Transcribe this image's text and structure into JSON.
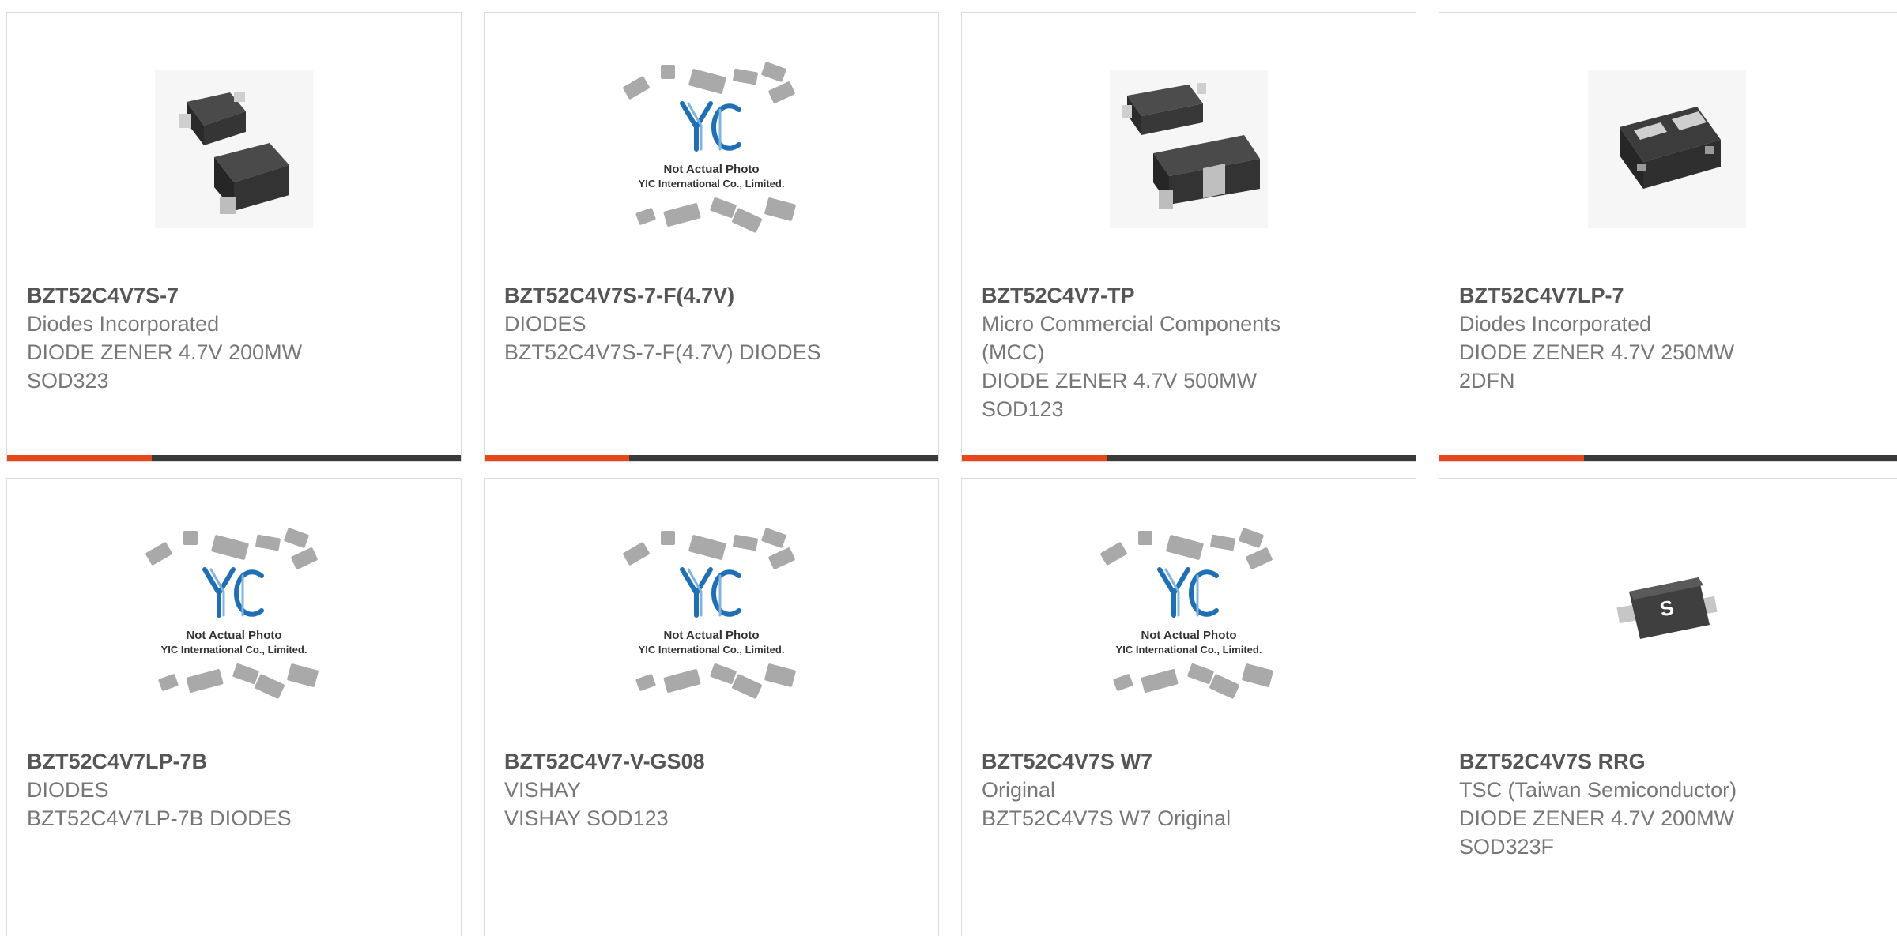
{
  "colors": {
    "accent": "#e8471b",
    "bar": "#3a3a3a",
    "title": "#555555",
    "text": "#777777"
  },
  "placeholder": {
    "line1": "Not Actual Photo",
    "line2": "YIC International Co., Limited."
  },
  "products": [
    {
      "part": "BZT52C4V7S-7",
      "lines": [
        "Diodes Incorporated",
        "DIODE ZENER 4.7V 200MW",
        "SOD323"
      ],
      "image": "sod323-diode-photo"
    },
    {
      "part": "BZT52C4V7S-7-F(4.7V)",
      "lines": [
        "DIODES",
        "BZT52C4V7S-7-F(4.7V) DIODES"
      ],
      "image": "yic-placeholder"
    },
    {
      "part": "BZT52C4V7-TP",
      "lines": [
        "Micro Commercial Components",
        "(MCC)",
        "DIODE ZENER 4.7V 500MW",
        "SOD123"
      ],
      "image": "sod123-diode-photo"
    },
    {
      "part": "BZT52C4V7LP-7",
      "lines": [
        "Diodes Incorporated",
        "DIODE ZENER 4.7V 250MW",
        "2DFN"
      ],
      "image": "dfn-diode-photo"
    },
    {
      "part": "BZT52C4V7LP-7B",
      "lines": [
        "DIODES",
        "BZT52C4V7LP-7B DIODES"
      ],
      "image": "yic-placeholder"
    },
    {
      "part": "BZT52C4V7-V-GS08",
      "lines": [
        "VISHAY",
        "VISHAY SOD123"
      ],
      "image": "yic-placeholder"
    },
    {
      "part": "BZT52C4V7S W7",
      "lines": [
        "Original",
        "BZT52C4V7S W7 Original"
      ],
      "image": "yic-placeholder"
    },
    {
      "part": "BZT52C4V7S RRG",
      "lines": [
        "TSC (Taiwan Semiconductor)",
        "DIODE ZENER 4.7V 200MW",
        "SOD323F"
      ],
      "image": "sod323f-diode-photo"
    }
  ]
}
